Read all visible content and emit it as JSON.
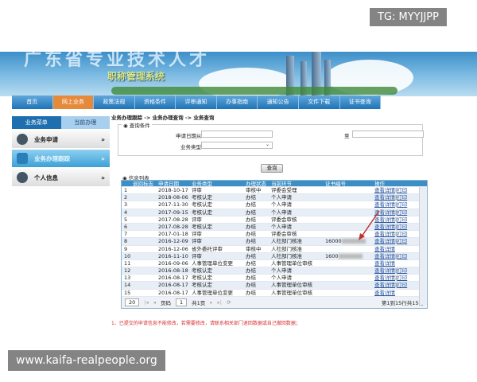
{
  "watermarks": {
    "top": "TG: MYYJJPP",
    "bottom": "www.kaifa-realpeople.org"
  },
  "banner": {
    "title": "广东省专业技术人才",
    "subtitle": "职称管理系统"
  },
  "nav": [
    "首页",
    "网上业务",
    "政策法规",
    "资格条件",
    "评审通知",
    "办事指南",
    "通知公告",
    "文件下载",
    "证书查询"
  ],
  "nav_active": 1,
  "sidebar": {
    "tabs": [
      "业务菜单",
      "当前办理"
    ],
    "items": [
      {
        "label": "业务申请",
        "icon": "user-icon"
      },
      {
        "label": "业务办理跟踪",
        "icon": "calendar-icon"
      },
      {
        "label": "个人信息",
        "icon": "user-icon"
      }
    ],
    "chevron": "»"
  },
  "breadcrumb": "业务办理跟踪 -> 业务办理查询 -> 业务查询",
  "query": {
    "legend": "查询条件",
    "date_from_label": "申请日期从",
    "date_to_label": "至",
    "type_label": "业务类型",
    "button": "查询"
  },
  "list_title": "信息列表",
  "table": {
    "headers": [
      "",
      "退回标志",
      "申请日期",
      "业务类型",
      "办理状态",
      "当前环节",
      "证书编号",
      "操作"
    ],
    "rows": [
      [
        "1",
        "",
        "2018-10-17",
        "评审",
        "审核中",
        "评委会受理",
        "",
        "查看详情",
        "打印"
      ],
      [
        "2",
        "",
        "2018-08-06",
        "考核认定",
        "办结",
        "个人申请",
        "",
        "查看详情",
        "打印"
      ],
      [
        "3",
        "",
        "2017-11-30",
        "考核认定",
        "办结",
        "个人申请",
        "",
        "查看详情",
        "打印"
      ],
      [
        "4",
        "",
        "2017-09-15",
        "考核认定",
        "办结",
        "个人申请",
        "",
        "查看详情",
        "打印"
      ],
      [
        "5",
        "",
        "2017-08-28",
        "评审",
        "办结",
        "评委会审核",
        "",
        "查看详情",
        "打印"
      ],
      [
        "6",
        "",
        "2017-08-28",
        "考核认定",
        "办结",
        "个人申请",
        "",
        "查看详情",
        "打印"
      ],
      [
        "7",
        "",
        "2017-01-18",
        "评审",
        "办结",
        "评委会审核",
        "",
        "查看详情",
        "打印"
      ],
      [
        "8",
        "",
        "2016-12-09",
        "评审",
        "办结",
        "人社部门核准",
        "16000",
        "查看详情",
        "打印"
      ],
      [
        "9",
        "",
        "2016-12-06",
        "省外委托评审",
        "审核中",
        "人社部门核准",
        "",
        "查看详情",
        ""
      ],
      [
        "10",
        "",
        "2016-11-10",
        "评审",
        "办结",
        "人社部门核准",
        "1600",
        "查看详情",
        "打印"
      ],
      [
        "11",
        "",
        "2016-09-06",
        "人事管理单位变更",
        "办结",
        "人事管理单位审核",
        "",
        "查看详情",
        ""
      ],
      [
        "12",
        "",
        "2016-08-18",
        "考核认定",
        "办结",
        "个人申请",
        "",
        "查看详情",
        "打印"
      ],
      [
        "13",
        "",
        "2016-08-17",
        "考核认定",
        "办结",
        "个人申请",
        "",
        "查看详情",
        "打印"
      ],
      [
        "14",
        "",
        "2016-08-17",
        "考核认定",
        "办结",
        "人事管理单位审核",
        "",
        "查看详情",
        "打印"
      ],
      [
        "15",
        "",
        "2016-08-17",
        "人事管理单位变更",
        "办结",
        "人事管理单位审核",
        "",
        "查看详情",
        ""
      ]
    ]
  },
  "pager": {
    "page_size": "20",
    "page_label": "页码",
    "page": "1",
    "total_pages": "共1页",
    "summary": "第1到15行共15行"
  },
  "note": "1、已提交的申请信息不能修改，若需要修改，请联系相关部门退回数据或自己撤回数据；"
}
